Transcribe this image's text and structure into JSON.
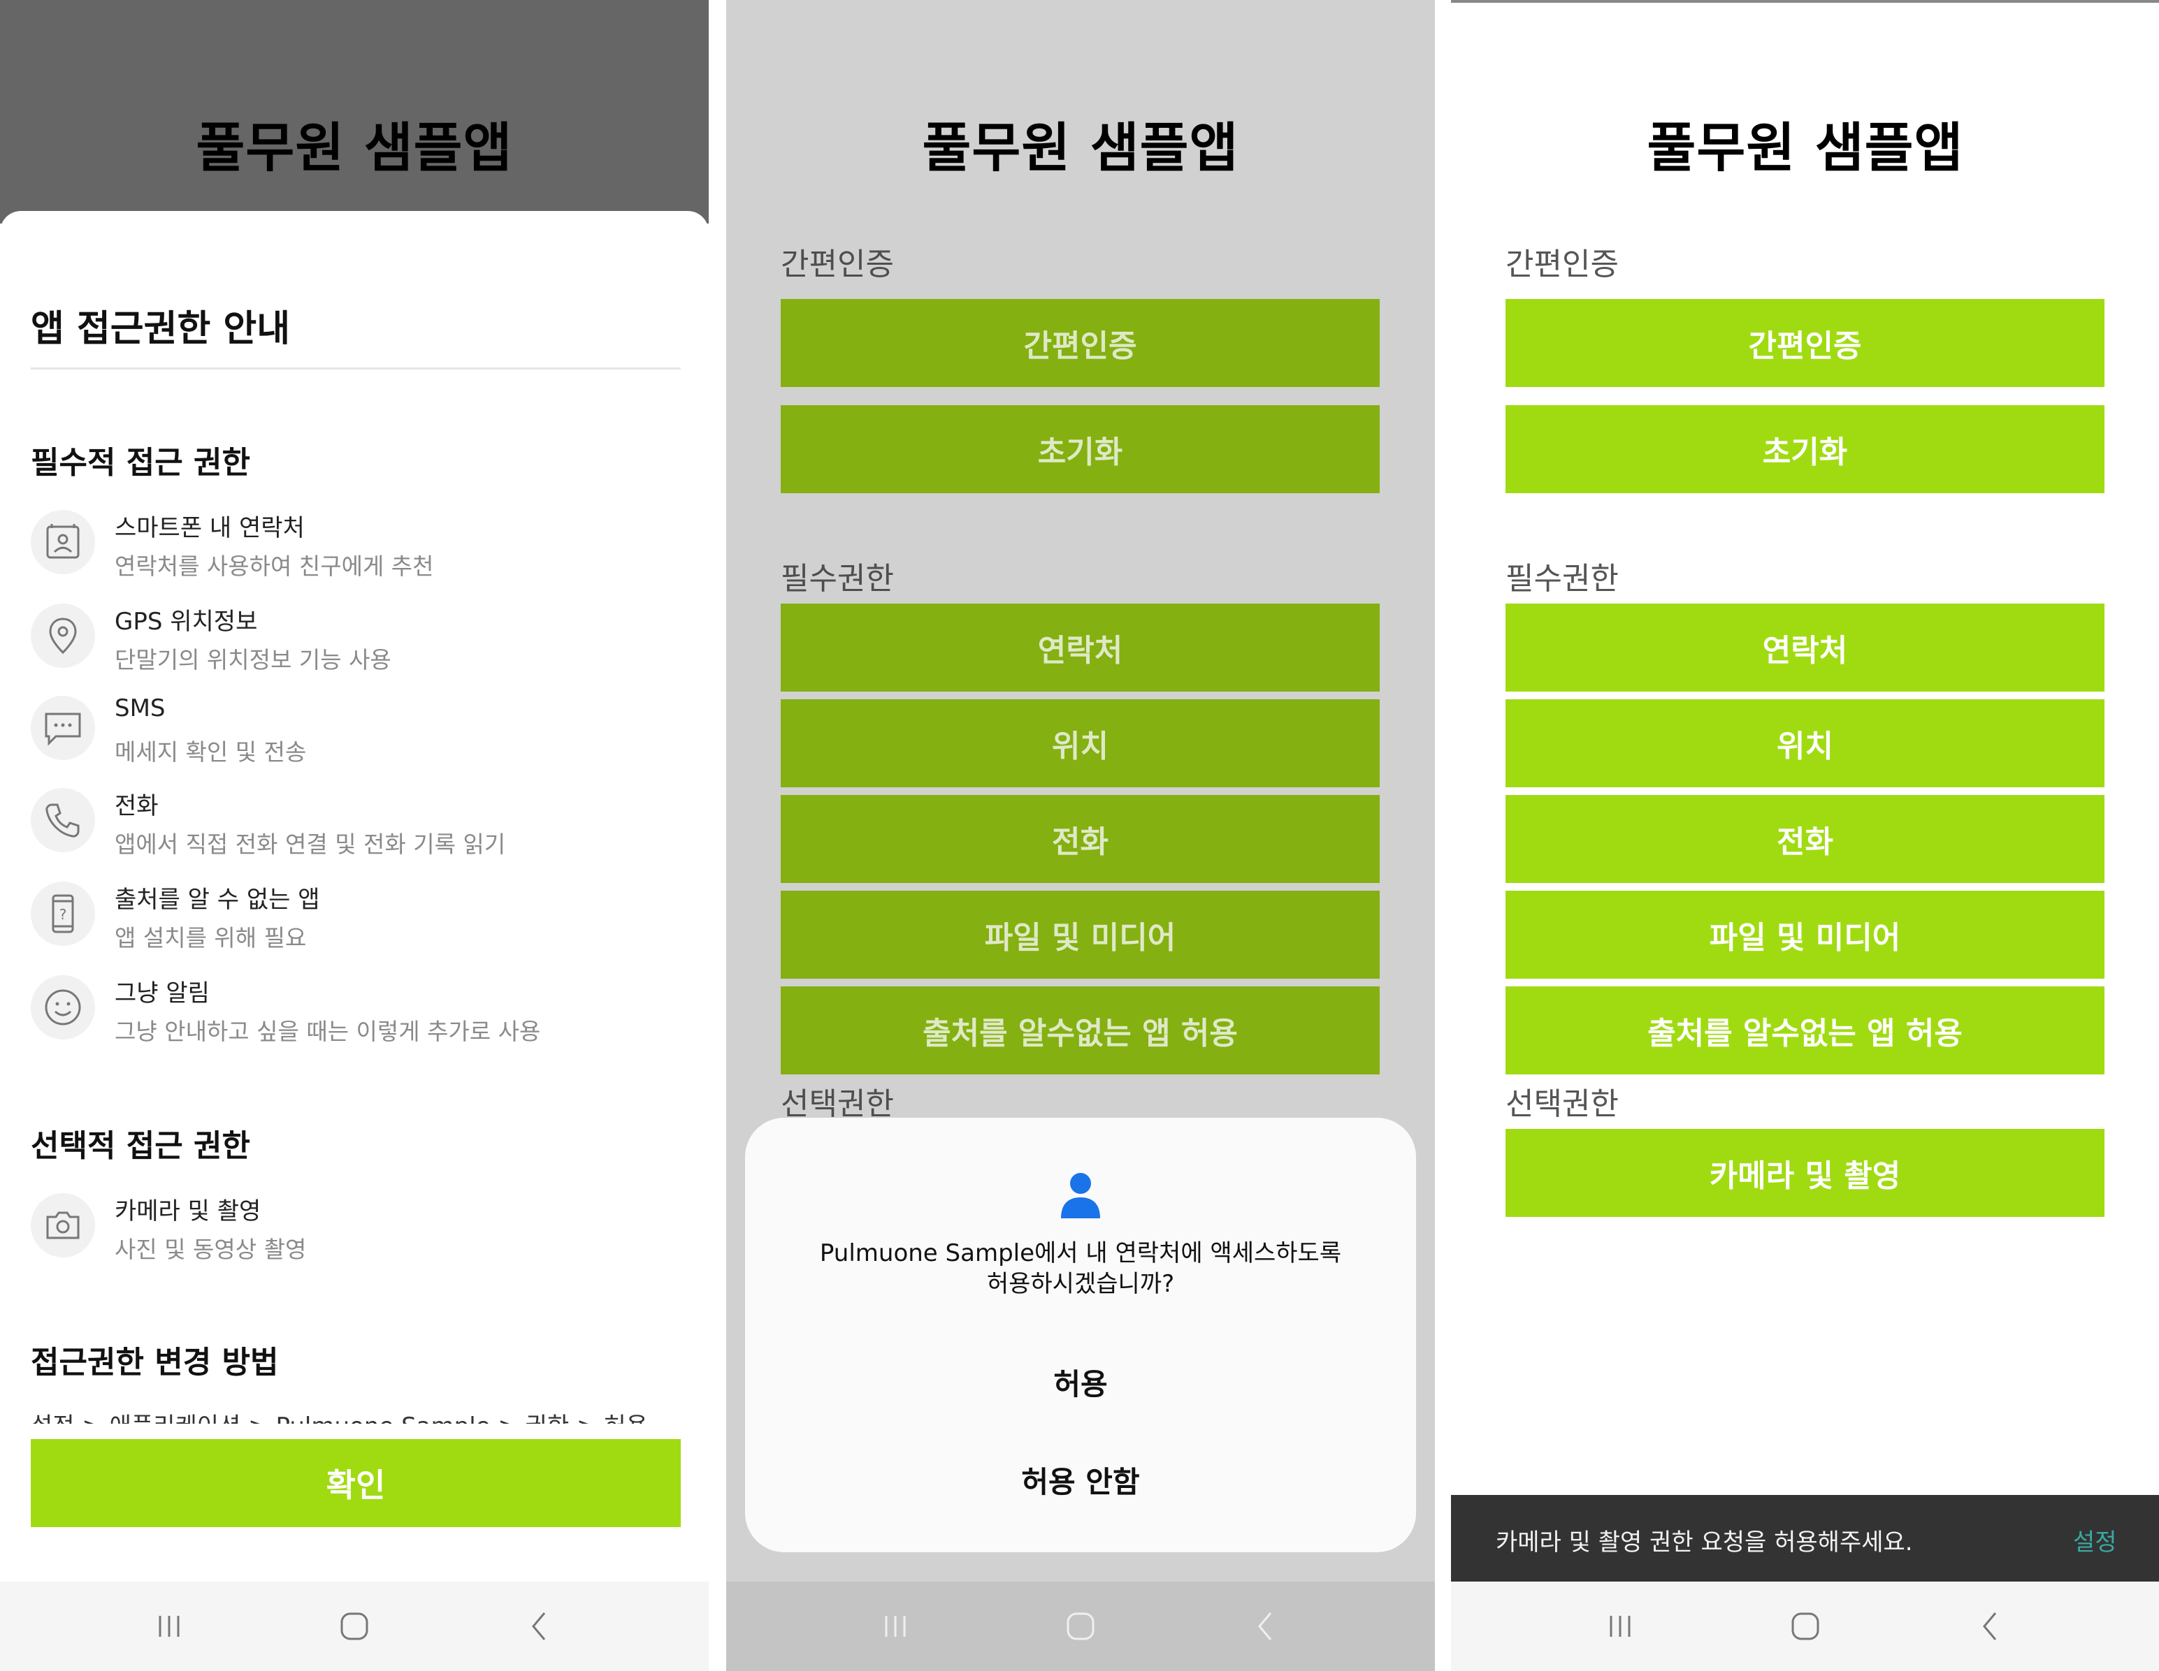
{
  "app_title": "풀무원 샘플앱",
  "panel1": {
    "sheet_title": "앱 접근권한 안내",
    "required_heading": "필수적 접근 권한",
    "required_items": [
      {
        "icon": "contacts-icon",
        "title": "스마트폰 내 연락처",
        "desc": "연락처를 사용하여 친구에게 추천"
      },
      {
        "icon": "location-pin-icon",
        "title": "GPS 위치정보",
        "desc": "단말기의 위치정보 기능 사용"
      },
      {
        "icon": "sms-icon",
        "title": "SMS",
        "desc": "메세지 확인 및 전송"
      },
      {
        "icon": "phone-icon",
        "title": "전화",
        "desc": "앱에서 직접 전화 연결 및 전화 기록 읽기"
      },
      {
        "icon": "unknown-app-icon",
        "title": "출처를 알 수 없는 앱",
        "desc": "앱 설치를 위해 필요"
      },
      {
        "icon": "smiley-icon",
        "title": "그냥 알림",
        "desc": "그냥 안내하고 싶을 때는 이렇게 추가로 사용"
      }
    ],
    "optional_heading": "선택적 접근 권한",
    "optional_items": [
      {
        "icon": "camera-icon",
        "title": "카메라 및 촬영",
        "desc": "사진 및 동영상 촬영"
      }
    ],
    "change_heading": "접근권한 변경 방법",
    "change_path": "설정 > 애플리케이션 > Pulmuone Sample > 권한 > 허용",
    "confirm_label": "확인"
  },
  "panel2": {
    "auth_label": "간편인증",
    "auth_buttons": [
      "간편인증",
      "초기화"
    ],
    "required_label": "필수권한",
    "required_buttons": [
      "연락처",
      "위치",
      "전화",
      "파일 및 미디어",
      "출처를 알수없는 앱 허용"
    ],
    "optional_label": "선택권한",
    "dialog": {
      "app_name": "Pulmuone Sample",
      "message_rest": "에서 내 연락처에 액세스하도록",
      "message_line2": "허용하시겠습니까?",
      "allow": "허용",
      "deny": "허용 안함"
    }
  },
  "panel3": {
    "auth_label": "간편인증",
    "auth_buttons": [
      "간편인증",
      "초기화"
    ],
    "required_label": "필수권한",
    "required_buttons": [
      "연락처",
      "위치",
      "전화",
      "파일 및 미디어",
      "출처를 알수없는 앱 허용"
    ],
    "optional_label": "선택권한",
    "optional_buttons": [
      "카메라 및 촬영"
    ],
    "snackbar_text": "카메라 및 촬영 권한 요청을 허용해주세요.",
    "snackbar_action": "설정"
  },
  "nav": {
    "recents": "recent-apps-icon",
    "home": "home-icon",
    "back": "back-icon"
  },
  "colors": {
    "accent": "#a0db12",
    "accent_dimmed": "#84b011",
    "overlay_header": "#666666",
    "snackbar_bg": "#333333",
    "snackbar_action": "#3aa8a0",
    "dialog_icon": "#1a73e8"
  }
}
